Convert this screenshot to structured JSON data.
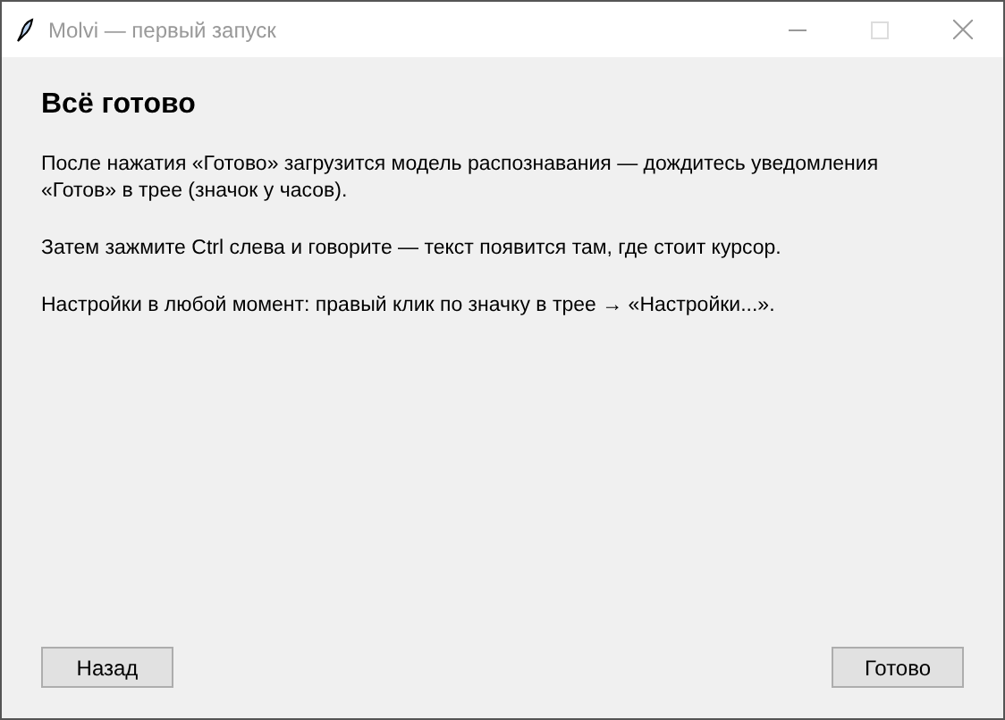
{
  "window": {
    "title": "Molvi — первый запуск",
    "active": false,
    "maximize_disabled": true
  },
  "heading": "Всё готово",
  "paragraphs": [
    "После нажатия «Готово» загрузится модель распознавания — дождитесь уведомления «Готов» в трее (значок у часов).",
    "Затем зажмите Ctrl слева и говорите — текст появится там, где стоит курсор.",
    "Настройки в любой момент: правый клик по значку в трее → «Настройки...»."
  ],
  "buttons": [
    "Назад",
    "Готово"
  ]
}
